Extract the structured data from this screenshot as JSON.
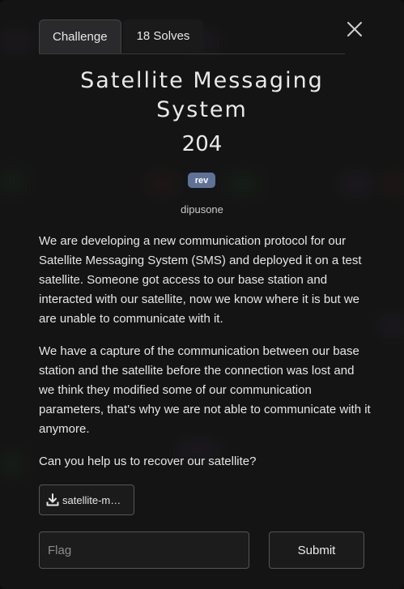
{
  "tabs": [
    {
      "label": "Challenge",
      "active": true
    },
    {
      "label": "18 Solves",
      "active": false
    }
  ],
  "challenge": {
    "name": "Satellite Messaging System",
    "points": "204",
    "category_tag": "rev",
    "author": "dipusone",
    "description": [
      "We are developing a new communication protocol for our Satellite Messaging System (SMS) and deployed it on a test satellite. Someone got access to our base station and interacted with our satellite, now we know where it is but we are unable to communicate with it.",
      "We have a capture of the communication between our base station and the satellite before the connection was lost and we think they modified some of our communication parameters, that's why we are not able to communicate with it anymore.",
      "Can you help us to recover our satellite?"
    ],
    "file_label": "satellite-m…"
  },
  "form": {
    "flag_placeholder": "Flag",
    "submit_label": "Submit"
  },
  "icons": {
    "close": "close-icon",
    "download": "download-icon"
  },
  "colors": {
    "tag_background": "#5f7196",
    "modal_background": "#161616"
  }
}
